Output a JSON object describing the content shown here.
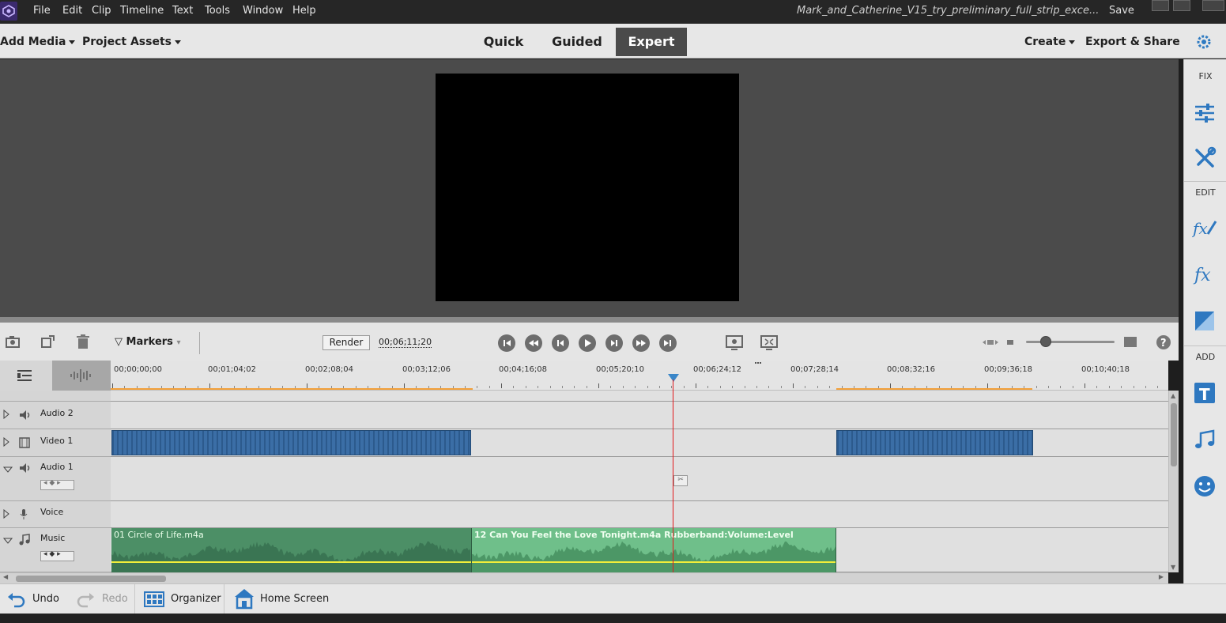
{
  "menubar": {
    "items": [
      "File",
      "Edit",
      "Clip",
      "Timeline",
      "Text",
      "Tools",
      "Window",
      "Help"
    ],
    "doc_title": "Mark_and_Catherine_V15_try_preliminary_full_strip_exce...",
    "save_label": "Save"
  },
  "modebar": {
    "add_media": "Add Media",
    "project_assets": "Project Assets",
    "tabs": [
      "Quick",
      "Guided",
      "Expert"
    ],
    "active_tab": "Expert",
    "create": "Create",
    "export_share": "Export & Share"
  },
  "right_panel": {
    "fix_label": "FIX",
    "edit_label": "EDIT",
    "add_label": "ADD",
    "icons": [
      "adjust-sliders-icon",
      "tools-icon",
      "fx-edit-icon",
      "fx-icon",
      "transitions-icon",
      "titles-icon",
      "music-icon",
      "graphics-icon"
    ]
  },
  "timeline_toolbar": {
    "markers_label": "Markers",
    "render_label": "Render",
    "timecode": "00;06;11;20",
    "zoom_level": 0.22
  },
  "ruler": {
    "labels": [
      "00;00;00;00",
      "00;01;04;02",
      "00;02;08;04",
      "00;03;12;06",
      "00;04;16;08",
      "00;05;20;10",
      "00;06;24;12",
      "00;07;28;14",
      "00;08;32;16",
      "00;09;36;18",
      "00;10;40;18"
    ]
  },
  "tracks": [
    {
      "name": "Audio 2",
      "kind": "audio",
      "expanded": false
    },
    {
      "name": "Video 1",
      "kind": "video",
      "expanded": false
    },
    {
      "name": "Audio 1",
      "kind": "audio",
      "expanded": true
    },
    {
      "name": "Voice",
      "kind": "voice",
      "expanded": false
    },
    {
      "name": "Music",
      "kind": "music",
      "expanded": true
    }
  ],
  "music_clips": [
    {
      "label": "01 Circle of Life.m4a"
    },
    {
      "label": "12 Can You Feel the Love Tonight.m4a Rubberband:Volume:Level"
    }
  ],
  "bottombar": {
    "undo": "Undo",
    "redo": "Redo",
    "organizer": "Organizer",
    "home_screen": "Home Screen"
  },
  "colors": {
    "video_clip": "#3b6ea6",
    "audio_clip_a": "#4c8f66",
    "audio_clip_b": "#6fbf8a",
    "playhead": "#e2191c",
    "accent": "#3a86c8"
  }
}
